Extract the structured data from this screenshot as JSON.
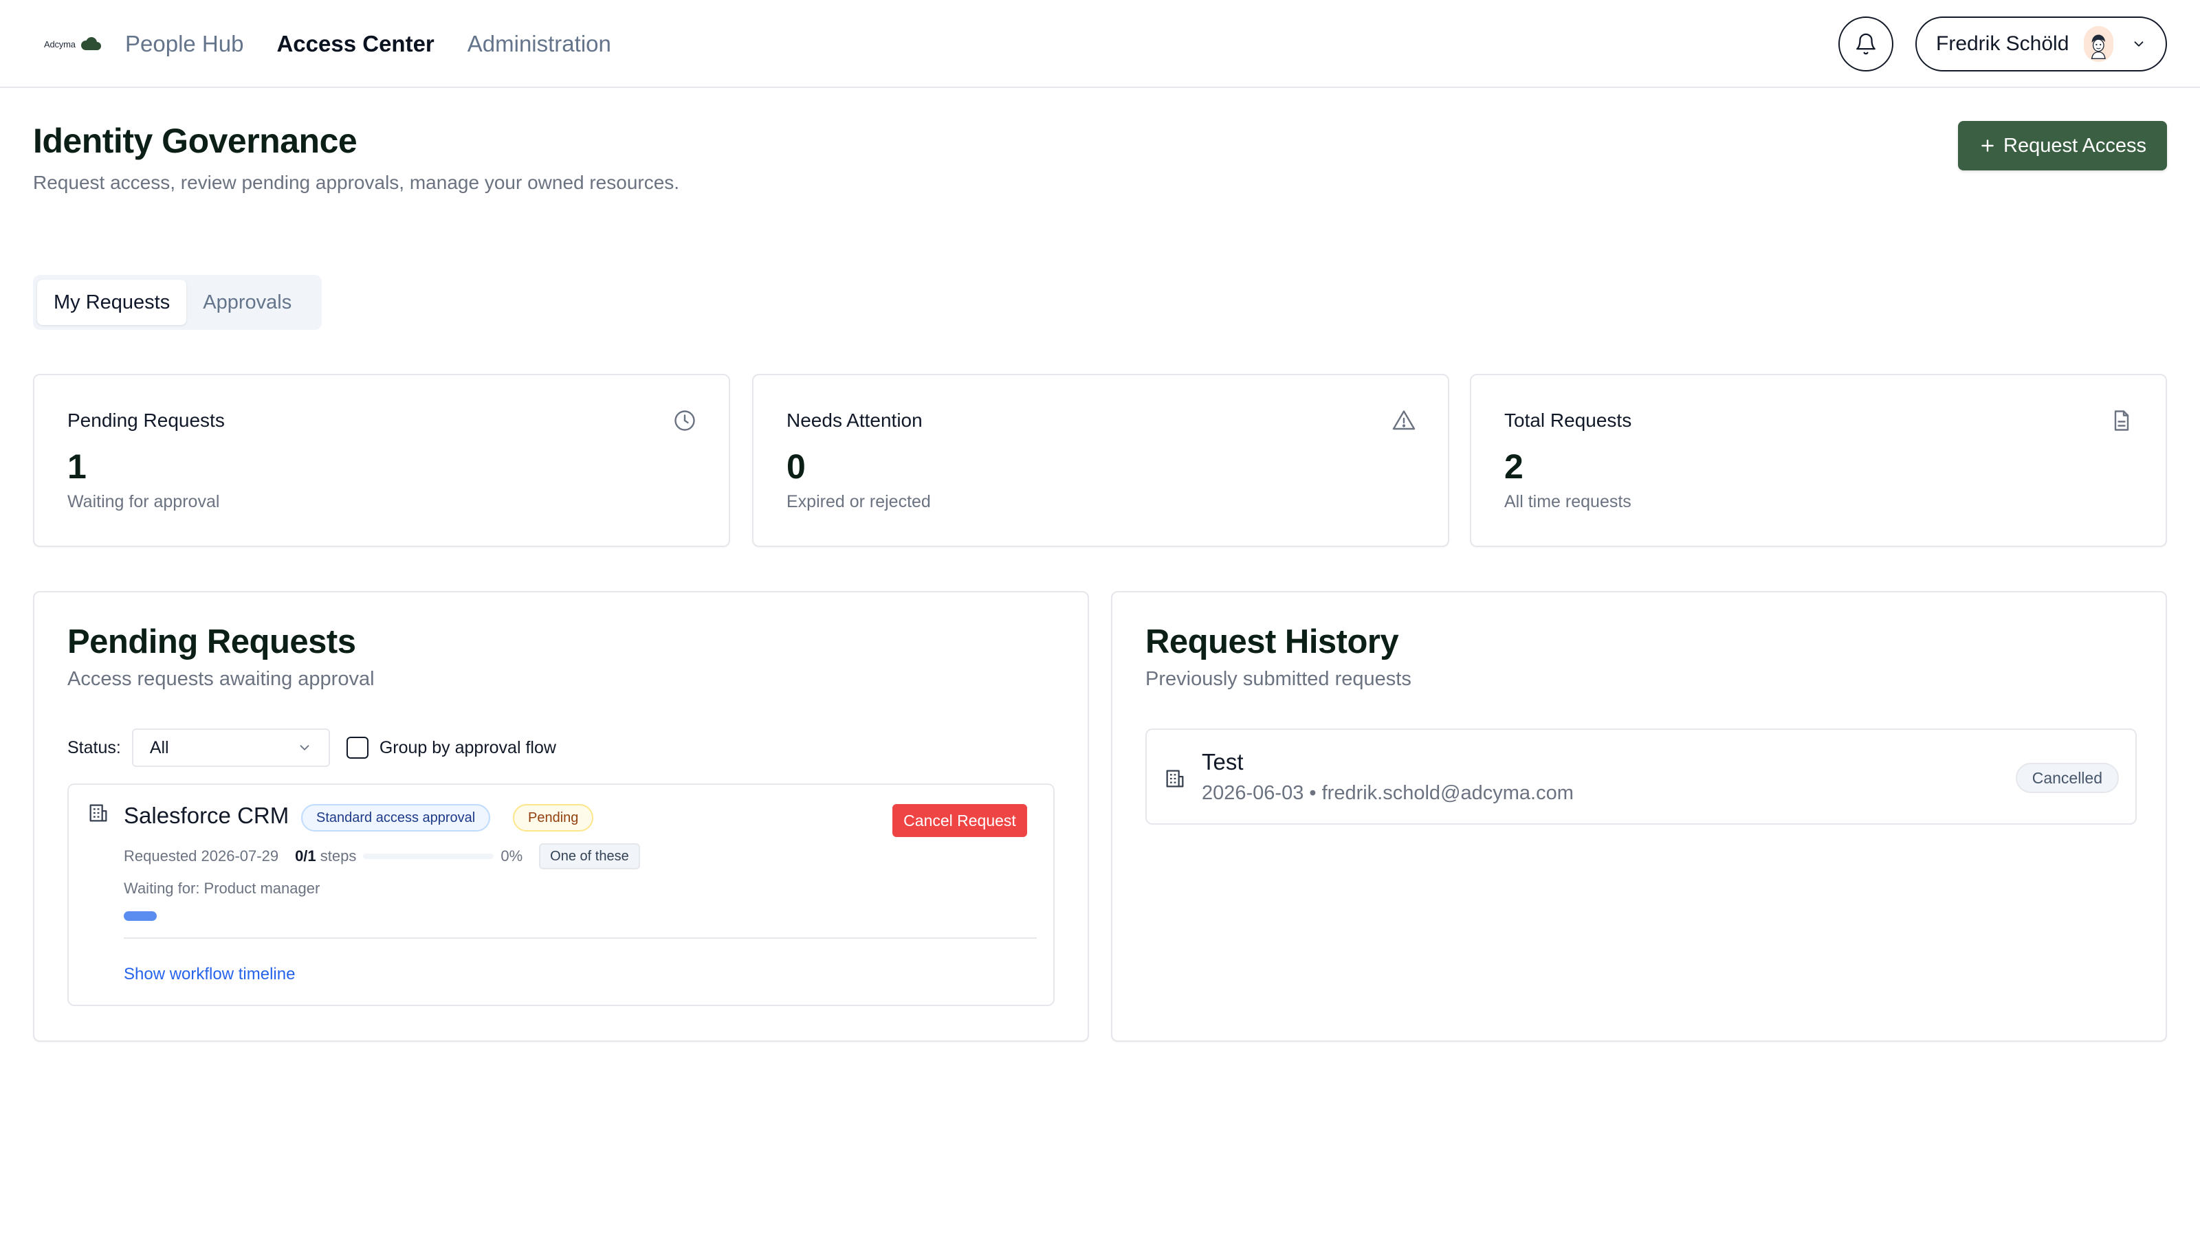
{
  "brand": {
    "name": "Adcyma",
    "logo_icon": "cloud-logo-icon",
    "logo_color": "#2f4f34"
  },
  "nav": {
    "links": [
      {
        "label": "People Hub",
        "active": false
      },
      {
        "label": "Access Center",
        "active": true
      },
      {
        "label": "Administration",
        "active": false
      }
    ]
  },
  "header_actions": {
    "bell_icon": "bell-icon",
    "user_name": "Fredrik Schöld",
    "avatar_icon": "avatar-icon",
    "chevron_icon": "chevron-down-icon"
  },
  "page": {
    "title": "Identity Governance",
    "subtitle": "Request access, review pending approvals, manage your owned resources.",
    "primary_action": {
      "icon": "plus-icon",
      "label": "Request Access",
      "color": "#3b5f42"
    }
  },
  "tabs": [
    {
      "label": "My Requests",
      "active": true
    },
    {
      "label": "Approvals",
      "active": false
    }
  ],
  "stats": [
    {
      "title": "Pending Requests",
      "value": "1",
      "subtitle": "Waiting for approval",
      "icon": "clock-icon"
    },
    {
      "title": "Needs Attention",
      "value": "0",
      "subtitle": "Expired or rejected",
      "icon": "warning-triangle-icon"
    },
    {
      "title": "Total Requests",
      "value": "2",
      "subtitle": "All time requests",
      "icon": "document-icon"
    }
  ],
  "pending_panel": {
    "title": "Pending Requests",
    "subtitle": "Access requests awaiting approval",
    "filter": {
      "status_label": "Status:",
      "status_value": "All",
      "group_label": "Group by approval flow",
      "group_checked": false
    },
    "requests": [
      {
        "resource_icon": "building-icon",
        "name": "Salesforce CRM",
        "flow_badge": "Standard access approval",
        "status_badge": "Pending",
        "cancel_label": "Cancel Request",
        "requested": "Requested 2026-07-29",
        "steps_done": "0/1",
        "steps_label": "steps",
        "progress_percent": 0,
        "progress_text": "0%",
        "rule": "One of these",
        "waiting_for": "Waiting for: Product manager",
        "timeline_link": "Show workflow timeline"
      }
    ]
  },
  "history_panel": {
    "title": "Request History",
    "subtitle": "Previously submitted requests",
    "items": [
      {
        "resource_icon": "building-icon",
        "name": "Test",
        "meta": "2026-06-03 • fredrik.schold@adcyma.com",
        "status": "Cancelled"
      }
    ]
  },
  "colors": {
    "accent": "#3b5f42",
    "danger": "#ef4444",
    "link": "#2563eb",
    "progress": "#5b8df0"
  }
}
